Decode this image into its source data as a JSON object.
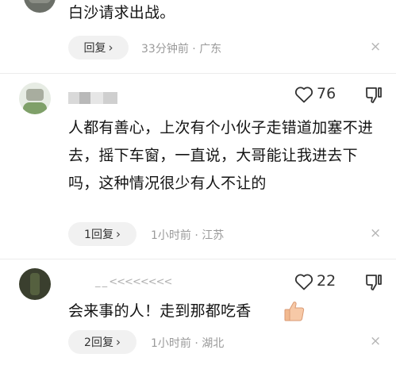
{
  "comments": [
    {
      "text": "白沙请求出战。",
      "reply_label": "回复",
      "time": "33分钟前",
      "location": "广东",
      "dot": "·",
      "close": "×"
    },
    {
      "username": "",
      "likes": "76",
      "text": "人都有善心，上次有个小伙子走错道加塞不进去，摇下车窗，一直说，大哥能让我进去下吗，这种情况很少有人不让的",
      "reply_label": "1回复",
      "time": "1小时前",
      "location": "江苏",
      "dot": "·",
      "close": "×"
    },
    {
      "username": "_ _ <<<<<<<<",
      "likes": "22",
      "text": "会来事的人！走到那都吃香",
      "reply_label": "2回复",
      "time": "1小时前",
      "location": "湖北",
      "dot": "·",
      "close": "×"
    }
  ],
  "colors": {
    "text": "#141414",
    "meta": "#9a9a9a",
    "reply_bg": "#f1f1f1",
    "divider": "#ececec"
  },
  "icons": [
    "heart-icon",
    "thumbs-down-icon",
    "chevron-right-icon",
    "close-icon",
    "thumbs-up-emoji"
  ]
}
